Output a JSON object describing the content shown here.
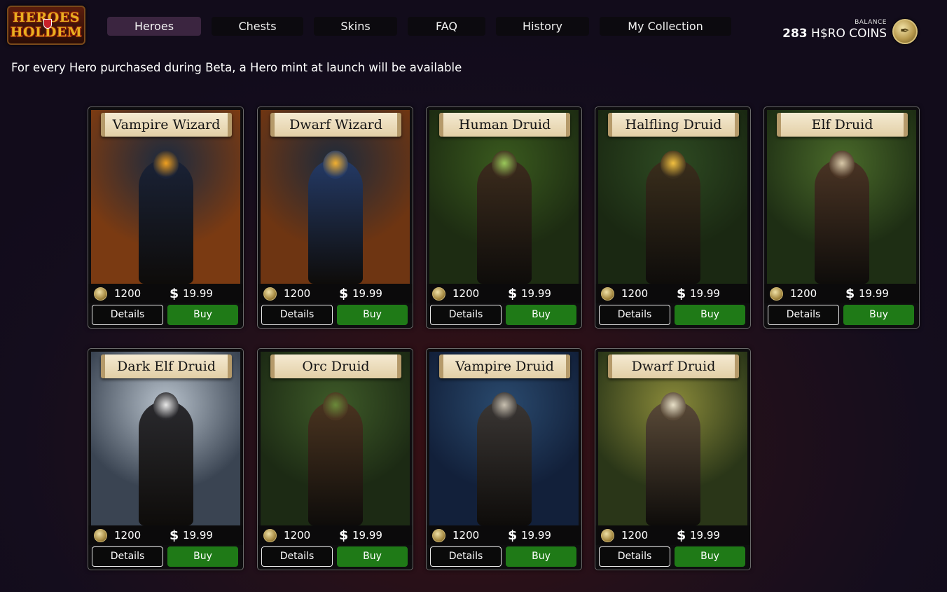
{
  "header": {
    "logo_text_top": "HEROES",
    "logo_text_bottom": "HOLDEM",
    "nav": [
      {
        "label": "Heroes",
        "active": true
      },
      {
        "label": "Chests",
        "active": false
      },
      {
        "label": "Skins",
        "active": false
      },
      {
        "label": "FAQ",
        "active": false
      },
      {
        "label": "History",
        "active": false
      },
      {
        "label": "My Collection",
        "active": false
      }
    ],
    "balance": {
      "caption": "BALANCE",
      "amount": "283",
      "currency": "H$RO COINS"
    }
  },
  "banner": "For every Hero purchased during Beta, a Hero mint at launch will be available",
  "cards": [
    {
      "title": "Vampire Wizard",
      "coins": "1200",
      "usd": "19.99",
      "details_label": "Details",
      "buy_label": "Buy",
      "theme": {
        "bg1": "#1b2a3f",
        "bg2": "#7a3a12",
        "figure": "#1a2236",
        "accent": "#f0a020"
      }
    },
    {
      "title": "Dwarf Wizard",
      "coins": "1200",
      "usd": "19.99",
      "details_label": "Details",
      "buy_label": "Buy",
      "theme": {
        "bg1": "#1d2a3b",
        "bg2": "#6e3512",
        "figure": "#243a66",
        "accent": "#f2b030"
      }
    },
    {
      "title": "Human Druid",
      "coins": "1200",
      "usd": "19.99",
      "details_label": "Details",
      "buy_label": "Buy",
      "theme": {
        "bg1": "#3a5a1e",
        "bg2": "#1d2c12",
        "figure": "#3c2c1d",
        "accent": "#9ac85a"
      }
    },
    {
      "title": "Halfling Druid",
      "coins": "1200",
      "usd": "19.99",
      "details_label": "Details",
      "buy_label": "Buy",
      "theme": {
        "bg1": "#2e4a22",
        "bg2": "#1a2812",
        "figure": "#3a2e1c",
        "accent": "#f2c040"
      }
    },
    {
      "title": "Elf Druid",
      "coins": "1200",
      "usd": "19.99",
      "details_label": "Details",
      "buy_label": "Buy",
      "theme": {
        "bg1": "#4a6a2a",
        "bg2": "#1e2e14",
        "figure": "#4a3424",
        "accent": "#d8c8a8"
      }
    },
    {
      "title": "Dark Elf Druid",
      "coins": "1200",
      "usd": "19.99",
      "details_label": "Details",
      "buy_label": "Buy",
      "theme": {
        "bg1": "#b8c2cc",
        "bg2": "#3a4452",
        "figure": "#2a2a2e",
        "accent": "#e8e8e8"
      }
    },
    {
      "title": "Orc Druid",
      "coins": "1200",
      "usd": "19.99",
      "details_label": "Details",
      "buy_label": "Buy",
      "theme": {
        "bg1": "#3e5a28",
        "bg2": "#1c2a14",
        "figure": "#4a3420",
        "accent": "#6a8a3a"
      }
    },
    {
      "title": "Vampire Druid",
      "coins": "1200",
      "usd": "19.99",
      "details_label": "Details",
      "buy_label": "Buy",
      "theme": {
        "bg1": "#2a4a6e",
        "bg2": "#12203a",
        "figure": "#3a3634",
        "accent": "#c8c0b0"
      }
    },
    {
      "title": "Dwarf Druid",
      "coins": "1200",
      "usd": "19.99",
      "details_label": "Details",
      "buy_label": "Buy",
      "theme": {
        "bg1": "#8a8a3a",
        "bg2": "#2a3618",
        "figure": "#5a4a38",
        "accent": "#e8e0c8"
      }
    }
  ]
}
